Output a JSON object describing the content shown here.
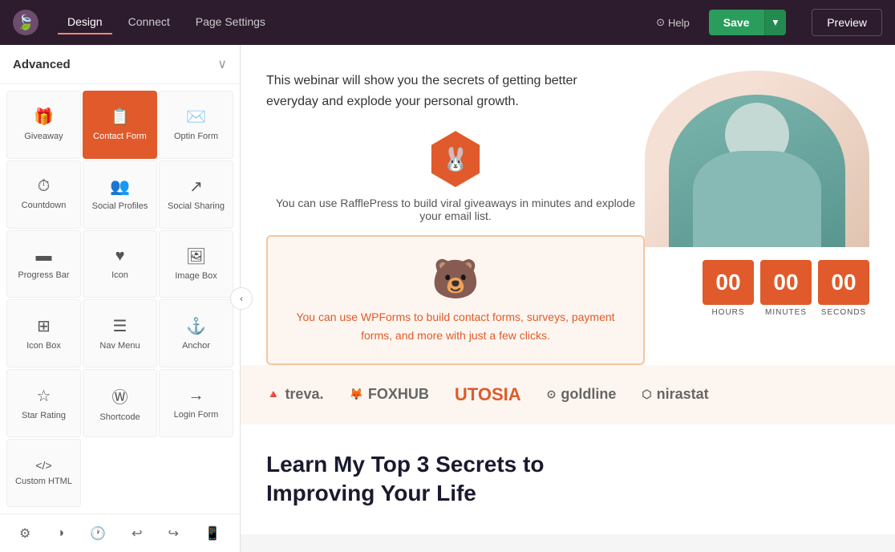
{
  "nav": {
    "tabs": [
      {
        "label": "Design",
        "active": true
      },
      {
        "label": "Connect",
        "active": false
      },
      {
        "label": "Page Settings",
        "active": false
      }
    ],
    "help_label": "Help",
    "save_label": "Save",
    "preview_label": "Preview"
  },
  "sidebar": {
    "title": "Advanced",
    "widgets": [
      {
        "id": "giveaway",
        "label": "Giveaway",
        "icon": "🎁",
        "active": false
      },
      {
        "id": "contact-form",
        "label": "Contact Form",
        "icon": "📋",
        "active": true
      },
      {
        "id": "optin-form",
        "label": "Optin Form",
        "icon": "✉️",
        "active": false
      },
      {
        "id": "countdown",
        "label": "Countdown",
        "icon": "⏱",
        "active": false
      },
      {
        "id": "social-profiles",
        "label": "Social Profiles",
        "icon": "👥",
        "active": false
      },
      {
        "id": "social-sharing",
        "label": "Social Sharing",
        "icon": "↗",
        "active": false
      },
      {
        "id": "progress-bar",
        "label": "Progress Bar",
        "icon": "▬",
        "active": false
      },
      {
        "id": "icon",
        "label": "Icon",
        "icon": "♥",
        "active": false
      },
      {
        "id": "image-box",
        "label": "Image Box",
        "icon": "🖼",
        "active": false
      },
      {
        "id": "icon-box",
        "label": "Icon Box",
        "icon": "⊞",
        "active": false
      },
      {
        "id": "nav-menu",
        "label": "Nav Menu",
        "icon": "☰",
        "active": false
      },
      {
        "id": "anchor",
        "label": "Anchor",
        "icon": "⚓",
        "active": false
      },
      {
        "id": "star-rating",
        "label": "Star Rating",
        "icon": "☆",
        "active": false
      },
      {
        "id": "shortcode",
        "label": "Shortcode",
        "icon": "Ⓦ",
        "active": false
      },
      {
        "id": "login-form",
        "label": "Login Form",
        "icon": "→",
        "active": false
      },
      {
        "id": "custom-html",
        "label": "Custom HTML",
        "icon": "</>",
        "active": false
      }
    ]
  },
  "content": {
    "hero_text": "This webinar will show you the secrets of getting better everyday and explode your personal growth.",
    "giveaway_desc": "You can use RafflePress to build viral giveaways in minutes and explode your email list.",
    "wpforms_text": "You can use WPForms to build contact forms, surveys, payment forms, and more with just a few clicks.",
    "countdown": {
      "hours": "00",
      "minutes": "00",
      "seconds": "00",
      "hours_label": "HOURS",
      "minutes_label": "MINUTES",
      "seconds_label": "SECONDS"
    },
    "logos": [
      {
        "name": "treva",
        "label": "treva.",
        "special": false
      },
      {
        "name": "foxhub",
        "label": "FOXHUB",
        "special": false
      },
      {
        "name": "utosia",
        "label": "UTOSIA",
        "special": true
      },
      {
        "name": "goldline",
        "label": "goldline",
        "special": false
      },
      {
        "name": "nirastat",
        "label": "nirastat",
        "special": false
      }
    ],
    "bottom_heading_line1": "Learn My Top 3 Secrets to",
    "bottom_heading_line2": "Improving Your Life"
  },
  "toolbar": {
    "buttons": [
      {
        "id": "settings",
        "icon": "⚙"
      },
      {
        "id": "layers",
        "icon": "◑"
      },
      {
        "id": "history",
        "icon": "🕐"
      },
      {
        "id": "undo",
        "icon": "↩"
      },
      {
        "id": "redo",
        "icon": "↪"
      },
      {
        "id": "mobile",
        "icon": "📱"
      }
    ]
  }
}
